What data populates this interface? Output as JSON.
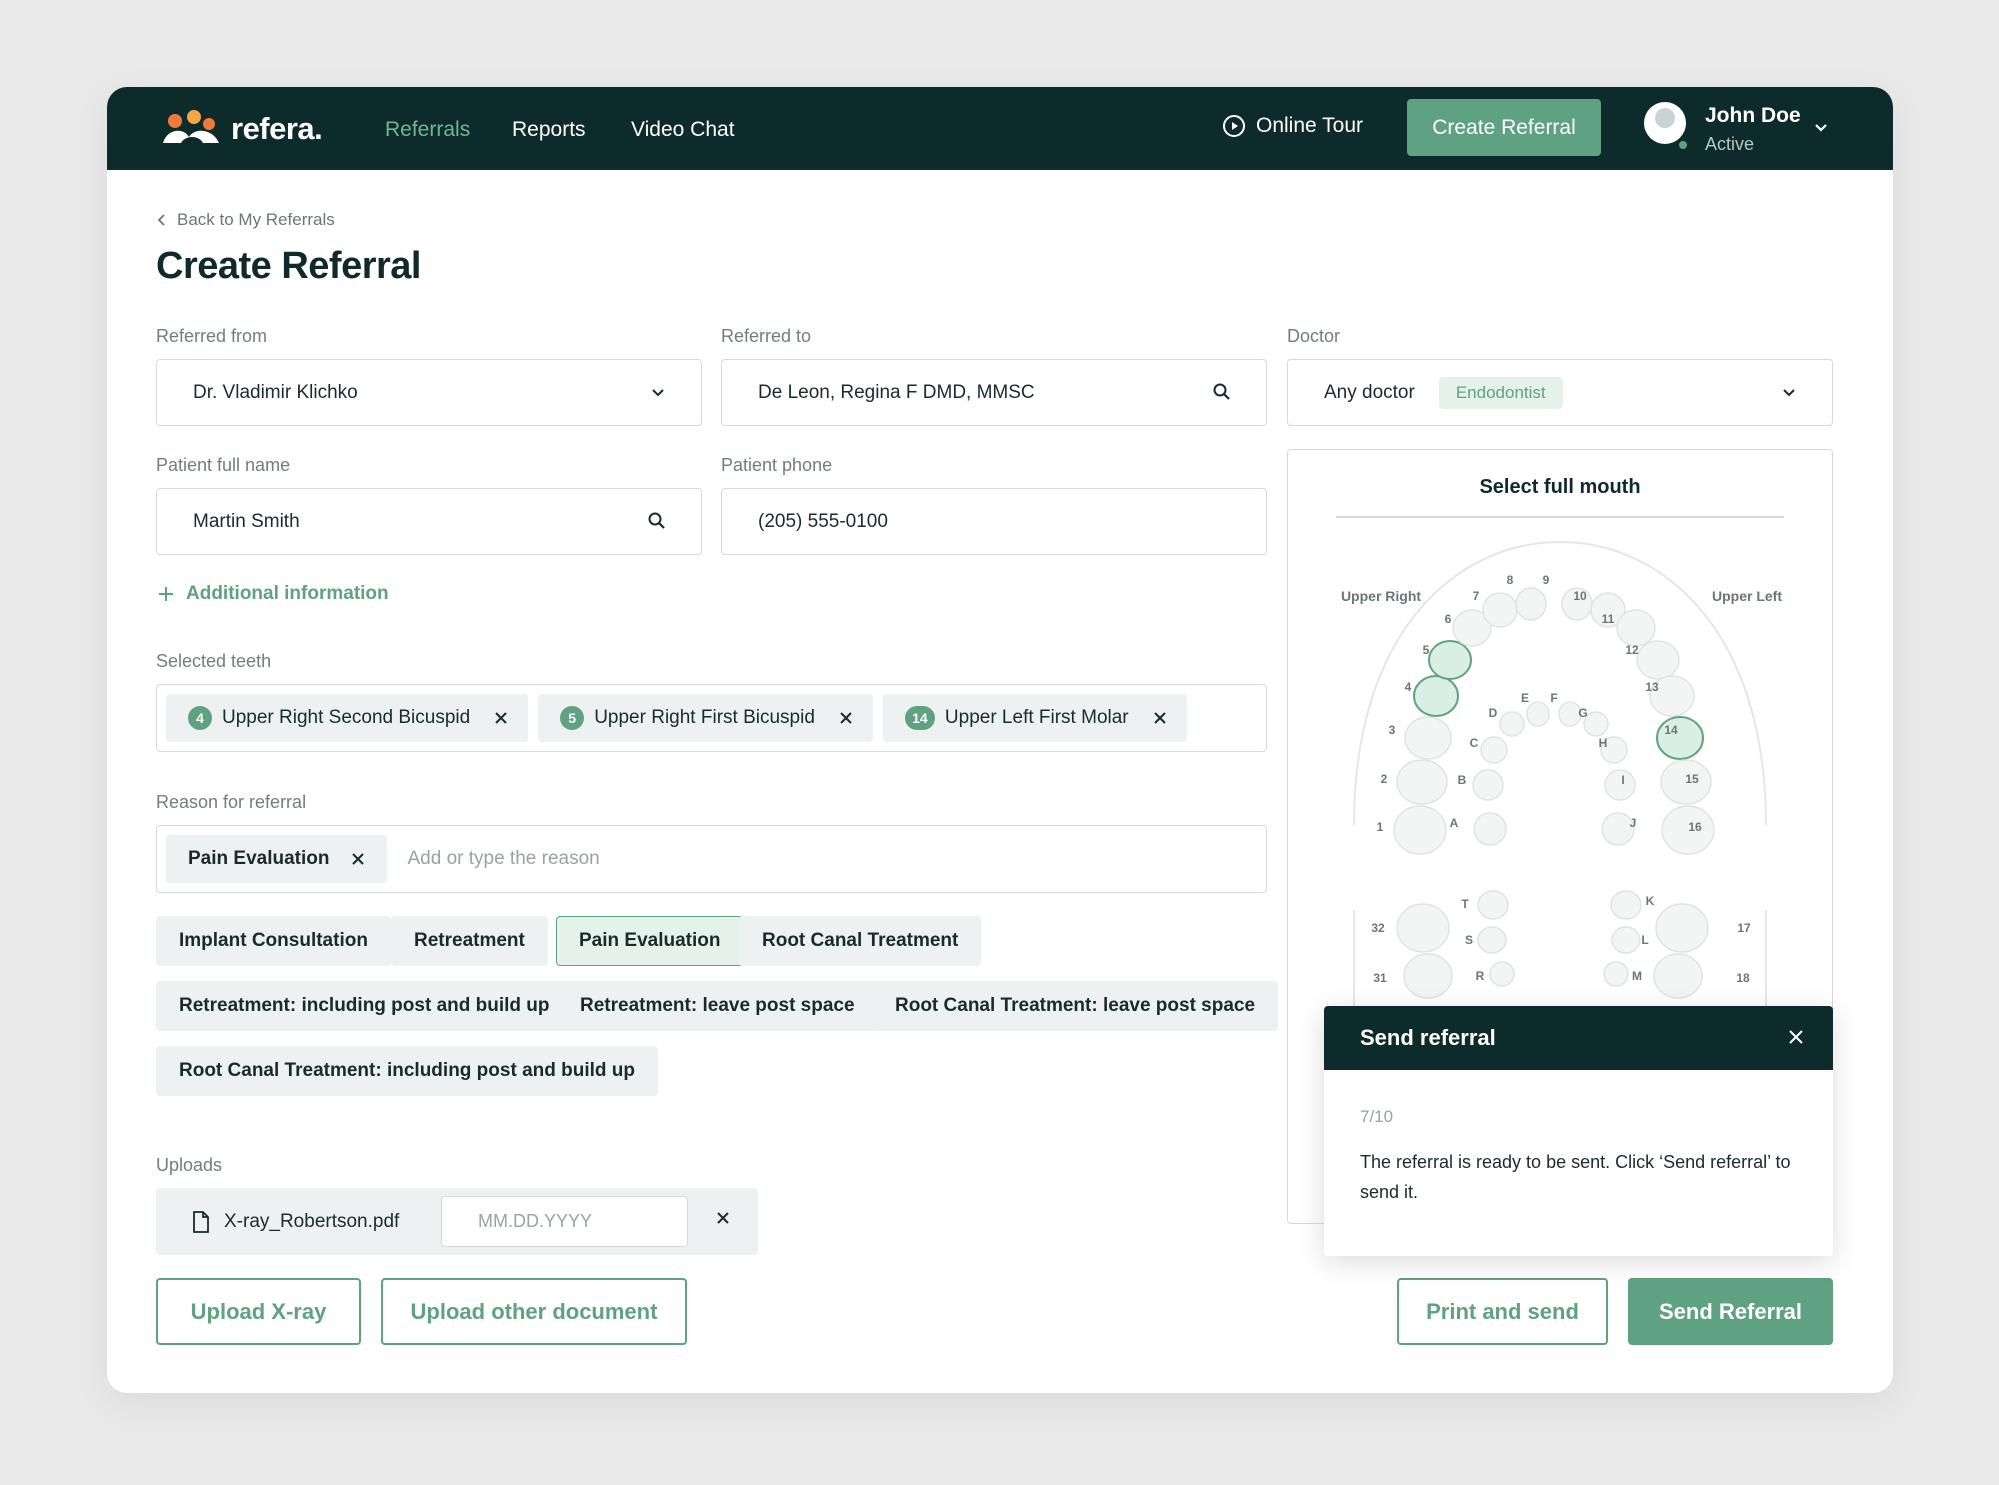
{
  "app": {
    "logo_text": "refera."
  },
  "nav": {
    "items": [
      {
        "label": "Referrals",
        "active": true
      },
      {
        "label": "Reports",
        "active": false
      },
      {
        "label": "Video Chat",
        "active": false
      }
    ],
    "tour_label": "Online Tour",
    "create_label": "Create Referral"
  },
  "user": {
    "name": "John Doe",
    "status": "Active"
  },
  "page": {
    "back_label": "Back to My Referrals",
    "title": "Create Referral"
  },
  "form": {
    "referred_from": {
      "label": "Referred from",
      "value": "Dr. Vladimir Klichko"
    },
    "referred_to": {
      "label": "Referred to",
      "value": "De Leon, Regina F DMD, MMSC"
    },
    "doctor": {
      "label": "Doctor",
      "value": "Any doctor",
      "badge": "Endodontist"
    },
    "patient_name": {
      "label": "Patient full name",
      "value": "Martin Smith"
    },
    "patient_phone": {
      "label": "Patient phone",
      "value": "(205) 555-0100"
    },
    "additional_info_label": "Additional information",
    "selected_teeth": {
      "label": "Selected teeth",
      "items": [
        {
          "num": "4",
          "label": "Upper Right Second Bicuspid"
        },
        {
          "num": "5",
          "label": "Upper Right First Bicuspid"
        },
        {
          "num": "14",
          "label": "Upper Left First Molar"
        }
      ]
    },
    "reason": {
      "label": "Reason for referral",
      "selected": "Pain Evaluation",
      "placeholder": "Add or type the reason",
      "options": [
        "Implant Consultation",
        "Retreatment",
        "Pain Evaluation",
        "Root Canal Treatment",
        "Retreatment: including post and build up",
        "Retreatment: leave post space",
        "Root Canal Treatment: leave post space",
        "Root Canal Treatment: including post and build up"
      ],
      "selected_option": "Pain Evaluation"
    },
    "uploads": {
      "label": "Uploads",
      "file_name": "X-ray_Robertson.pdf",
      "date_placeholder": "MM.DD.YYYY"
    },
    "buttons": {
      "upload_xray": "Upload X-ray",
      "upload_other": "Upload other document",
      "print_send": "Print and send",
      "send": "Send Referral"
    }
  },
  "mouth": {
    "title": "Select full mouth",
    "quadrant_upper_right": "Upper Right",
    "quadrant_upper_left": "Upper Left",
    "selected_teeth": [
      "4",
      "5",
      "14"
    ],
    "upper_numbers": [
      "1",
      "2",
      "3",
      "4",
      "5",
      "6",
      "7",
      "8",
      "9",
      "10",
      "11",
      "12",
      "13",
      "14",
      "15",
      "16"
    ],
    "upper_letters": [
      "A",
      "B",
      "C",
      "D",
      "E",
      "F",
      "G",
      "H",
      "I",
      "J"
    ],
    "lower_numbers": [
      "32",
      "31",
      "17",
      "18"
    ],
    "lower_letters": [
      "T",
      "S",
      "R",
      "K",
      "L",
      "M"
    ]
  },
  "popover": {
    "title": "Send referral",
    "step": "7/10",
    "body": "The referral is ready to be sent. Click ‘Send referral’ to send it."
  },
  "colors": {
    "brand_dark": "#0e2b2c",
    "accent": "#5fa281",
    "chip_bg": "#eef1f1"
  }
}
